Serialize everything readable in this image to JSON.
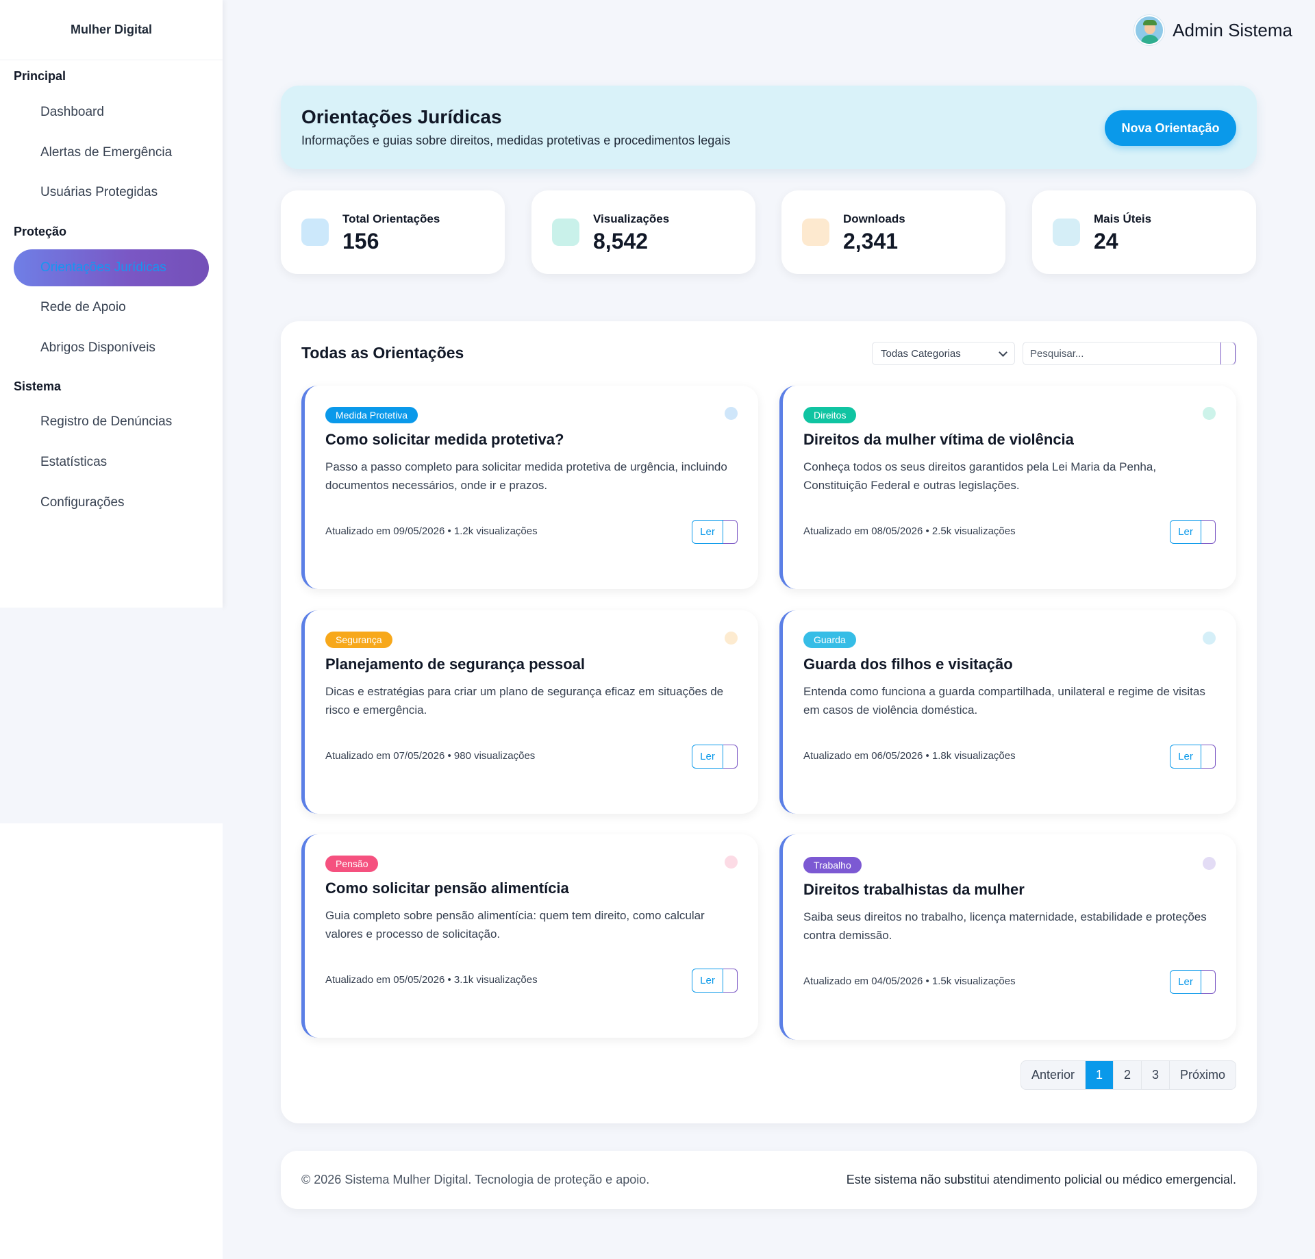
{
  "sidebar": {
    "brand": "Mulher Digital",
    "sections": [
      "Principal",
      "Proteção",
      "Sistema"
    ],
    "items": [
      {
        "label": "Dashboard"
      },
      {
        "label": "Alertas de Emergência"
      },
      {
        "label": "Usuárias Protegidas"
      },
      {
        "label": "Orientações Jurídicas",
        "active": true
      },
      {
        "label": "Rede de Apoio"
      },
      {
        "label": "Abrigos Disponíveis"
      },
      {
        "label": "Registro de Denúncias"
      },
      {
        "label": "Estatísticas"
      },
      {
        "label": "Configurações"
      }
    ]
  },
  "header": {
    "user_name": "Admin Sistema",
    "avatar_icon": "user-avatar-icon"
  },
  "hero": {
    "title": "Orientações Jurídicas",
    "subtitle": "Informações e guias sobre direitos, medidas protetivas e procedimentos legais",
    "button_label": "Nova Orientação"
  },
  "stats": [
    {
      "label": "Total Orientações",
      "value": "156",
      "icon_color": "#cce8fb"
    },
    {
      "label": "Visualizações",
      "value": "8,542",
      "icon_color": "#c9f1ea"
    },
    {
      "label": "Downloads",
      "value": "2,341",
      "icon_color": "#fde9cf"
    },
    {
      "label": "Mais Úteis",
      "value": "24",
      "icon_color": "#d5eef7"
    }
  ],
  "panel": {
    "title": "Todas as Orientações",
    "category_select": "Todas Categorias",
    "search_placeholder": "Pesquisar...",
    "read_label": "Ler"
  },
  "cards": [
    {
      "badge": "Medida Protetiva",
      "badge_color": "#0a99ea",
      "dot_color": "#cfe6fa",
      "title": "Como solicitar medida protetiva?",
      "description": "Passo a passo completo para solicitar medida protetiva de urgência, incluindo documentos necessários, onde ir e prazos.",
      "meta": "Atualizado em 09/05/2026 • 1.2k visualizações"
    },
    {
      "badge": "Direitos",
      "badge_color": "#10c4a2",
      "dot_color": "#cdf3ea",
      "title": "Direitos da mulher vítima de violência",
      "description": "Conheça todos os seus direitos garantidos pela Lei Maria da Penha, Constituição Federal e outras legislações.",
      "meta": "Atualizado em 08/05/2026 • 2.5k visualizações"
    },
    {
      "badge": "Segurança",
      "badge_color": "#f7a81b",
      "dot_color": "#fdebd0",
      "title": "Planejamento de segurança pessoal",
      "description": "Dicas e estratégias para criar um plano de segurança eficaz em situações de risco e emergência.",
      "meta": "Atualizado em 07/05/2026 • 980 visualizações"
    },
    {
      "badge": "Guarda",
      "badge_color": "#36bde6",
      "dot_color": "#d5eff8",
      "title": "Guarda dos filhos e visitação",
      "description": "Entenda como funciona a guarda compartilhada, unilateral e regime de visitas em casos de violência doméstica.",
      "meta": "Atualizado em 06/05/2026 • 1.8k visualizações"
    },
    {
      "badge": "Pensão",
      "badge_color": "#f5517f",
      "dot_color": "#fcdbe5",
      "title": "Como solicitar pensão alimentícia",
      "description": "Guia completo sobre pensão alimentícia: quem tem direito, como calcular valores e processo de solicitação.",
      "meta": "Atualizado em 05/05/2026 • 3.1k visualizações"
    },
    {
      "badge": "Trabalho",
      "badge_color": "#7c59d3",
      "dot_color": "#e3dcf5",
      "title": "Direitos trabalhistas da mulher",
      "description": "Saiba seus direitos no trabalho, licença maternidade, estabilidade e proteções contra demissão.",
      "meta": "Atualizado em 04/05/2026 • 1.5k visualizações"
    }
  ],
  "pagination": {
    "prev": "Anterior",
    "pages": [
      "1",
      "2",
      "3"
    ],
    "current": "1",
    "next": "Próximo"
  },
  "footer": {
    "left": "© 2026 Sistema Mulher Digital. Tecnologia de proteção e apoio.",
    "right": "Este sistema não substitui atendimento policial ou médico emergencial."
  },
  "colors": {
    "accent": "#0a99ea",
    "hero_bg": "#d9f2f9",
    "card_border": "#5b7fe6"
  }
}
